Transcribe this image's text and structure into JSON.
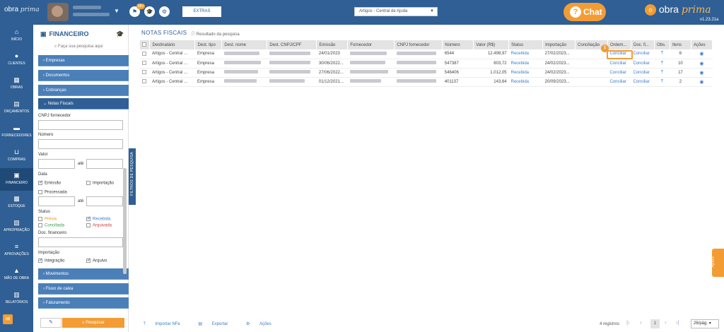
{
  "topbar": {
    "logo_text": "obra",
    "logo_italic": "prima",
    "notif_badge": "99+",
    "extras_label": "EXTRAS",
    "help_select_value": "Artigos - Central de Ajuda",
    "chat_label": "Chat",
    "brand_text": "obra",
    "brand_italic": "prima",
    "version": "v1.23.21a",
    "icons": [
      "caret-down-icon",
      "flag-icon",
      "graduation-cap-icon",
      "gear-icon",
      "mobile-icon",
      "monitor-icon"
    ]
  },
  "nav": {
    "items": [
      {
        "label": "INÍCIO",
        "icon": "home-icon"
      },
      {
        "label": "CLIENTES",
        "icon": "user-icon"
      },
      {
        "label": "OBRAS",
        "icon": "building-icon"
      },
      {
        "label": "ORÇAMENTOS",
        "icon": "document-icon"
      },
      {
        "label": "FORNECEDORES",
        "icon": "truck-icon"
      },
      {
        "label": "COMPRAS",
        "icon": "cart-icon"
      },
      {
        "label": "FINANCEIRO",
        "icon": "calculator-icon"
      },
      {
        "label": "ESTOQUE",
        "icon": "boxes-icon"
      },
      {
        "label": "APROPRIAÇÃO",
        "icon": "file-icon"
      },
      {
        "label": "APROVAÇÕES",
        "icon": "check-list-icon"
      },
      {
        "label": "MÃO DE OBRA",
        "icon": "worker-icon"
      },
      {
        "label": "RELATÓRIOS",
        "icon": "report-icon"
      }
    ]
  },
  "panel": {
    "title": "FINANCEIRO",
    "search_placeholder": "Faça sua pesquisa aqui",
    "accordions_top": [
      "Empresas",
      "Documentos",
      "Cobranças"
    ],
    "open_section": "Notas Fiscais",
    "fields": {
      "cnpj_label": "CNPJ fornecedor",
      "numero_label": "Número",
      "valor_label": "Valor",
      "ate1": "até",
      "data_label": "Data",
      "emissao": "Emissão",
      "importacao": "Importação",
      "processada": "Processada",
      "ate2": "até",
      "status_label": "Status",
      "previa": "Prévia",
      "recebida": "Recebida",
      "conciliada": "Conciliada",
      "arquivada": "Arquivada",
      "doc_financeiro_label": "Doc. financeiro",
      "importacao_label": "Importação",
      "integracao": "Integração",
      "arquivo": "Arquivo"
    },
    "accordions_bottom": [
      "Movimentos",
      "Fluxo de caixa",
      "Faturamento"
    ],
    "search_button": "Pesquisar",
    "colors": {
      "previa": "#e0a020",
      "conciliada": "#3aa050",
      "recebida": "#3d7cc9",
      "arquivada": "#d04040"
    }
  },
  "filters_tab": "FILTROS DE PESQUISA",
  "main": {
    "title": "NOTAS FISCAIS",
    "result_label": "Resultado da pesquisa",
    "columns": [
      "Destinatário",
      "Dest. tipo",
      "Dest. nome",
      "Dest. CNPJ/CPF",
      "Emissão",
      "Fornecedor",
      "CNPJ fornecedor",
      "Número",
      "Valor (R$)",
      "Status",
      "Importação",
      "Conciliação",
      "Ordem...",
      "Doc. fi...",
      "Obs.",
      "Itens",
      "Ações"
    ],
    "rows": [
      {
        "destinatario": "Artigos - Central ...",
        "tipo": "Empresa",
        "emissao": "24/01/2023",
        "numero": "6544",
        "valor": "12.498,97",
        "status": "Recebida",
        "importacao": "27/02/2023...",
        "ordem": "Conciliar",
        "doc": "Conciliar",
        "itens": "6"
      },
      {
        "destinatario": "Artigos - Central ...",
        "tipo": "Empresa",
        "emissao": "30/06/2022...",
        "numero": "547387",
        "valor": "803,72",
        "status": "Recebida",
        "importacao": "24/02/2023...",
        "ordem": "Conciliar",
        "doc": "Conciliar",
        "itens": "10"
      },
      {
        "destinatario": "Artigos - Central ...",
        "tipo": "Empresa",
        "emissao": "27/06/2022...",
        "numero": "546406",
        "valor": "1.012,05",
        "status": "Recebida",
        "importacao": "24/02/2023...",
        "ordem": "Conciliar",
        "doc": "Conciliar",
        "itens": "17"
      },
      {
        "destinatario": "Artigos - Central ...",
        "tipo": "Empresa",
        "emissao": "01/12/2021...",
        "numero": "401137",
        "valor": "143,64",
        "status": "Recebida",
        "importacao": "20/09/2023...",
        "ordem": "Conciliar",
        "doc": "Conciliar",
        "itens": "2"
      }
    ],
    "highlight_badge": "1"
  },
  "ajuda_tab": "Ajuda",
  "bottom": {
    "import_label": "Importar NFe",
    "export_label": "Exportar",
    "actions_label": "Ações",
    "records": "4 registros",
    "current_page": "1",
    "per_page": "26/pág."
  }
}
